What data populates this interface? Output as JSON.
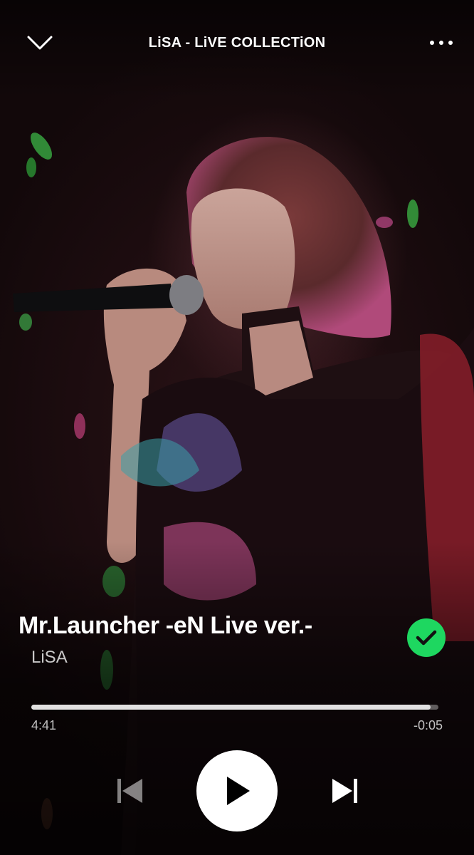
{
  "header": {
    "title": "LiSA - LiVE COLLECTiON",
    "collapse_icon": "chevron-down-icon",
    "more_icon": "more-options-icon"
  },
  "track": {
    "title": "Mr.Launcher -eN Live ver.-",
    "artist": "LiSA",
    "liked": true,
    "liked_icon": "check-icon",
    "accent_color": "#1ed760"
  },
  "progress": {
    "elapsed": "4:41",
    "remaining": "-0:05",
    "fraction": 0.98
  },
  "controls": {
    "previous_icon": "skip-previous-icon",
    "play_icon": "play-icon",
    "next_icon": "skip-next-icon",
    "previous_enabled": false
  }
}
